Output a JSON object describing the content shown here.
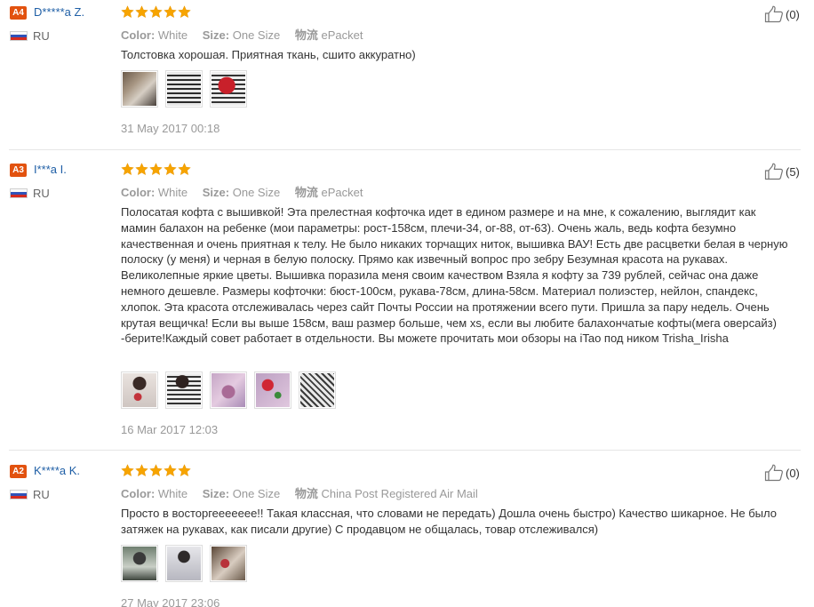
{
  "reviews": [
    {
      "level": "A4",
      "name": "D*****a Z.",
      "country": "RU",
      "rating": 5,
      "color_label": "Color:",
      "color_value": "White",
      "size_label": "Size:",
      "size_value": "One Size",
      "shipping_label": "物流",
      "shipping_value": "ePacket",
      "text": "Толстовка хорошая. Приятная ткань, сшито аккуратно)",
      "date": "31 May 2017 00:18",
      "helpful_count": "(0)"
    },
    {
      "level": "A3",
      "name": "I***a I.",
      "country": "RU",
      "rating": 5,
      "color_label": "Color:",
      "color_value": "White",
      "size_label": "Size:",
      "size_value": "One Size",
      "shipping_label": "物流",
      "shipping_value": "ePacket",
      "text": "Полосатая кофта с вышивкой! Эта прелестная кофточка идет в едином размере и на мне, к сожалению, выглядит как мамин балахон на ребенке (мои параметры: рост-158см, плечи-34, ог-88, от-63). Очень жаль, ведь кофта безумно качественная и очень приятная к телу. Не было никаких торчащих ниток, вышивка ВАУ! Есть две расцветки белая в черную полоску (у меня) и черная в белую полоску. Прямо как извечный вопрос про зебру Безумная красота на рукавах. Великолепные яркие цветы. Вышивка поразила меня своим качеством Взяла я кофту за 739 рублей, сейчас она даже немного дешевле. Размеры кофточки: бюст-100см, рукава-78см, длина-58см. Материал полиэстер, нейлон, спандекс, хлопок. Эта красота отслеживалась через сайт Почты России на протяжении всего пути. Пришла за пару недель. Очень крутая вещичка! Если вы выше 158см, ваш размер больше, чем xs, если вы любите балахончатые кофты(мега оверсайз) -берите!Каждый совет работает в отдельности. Вы можете прочитать мои обзоры на iTao под ником Trisha_Irisha",
      "date": "16 Mar 2017 12:03",
      "helpful_count": "(5)"
    },
    {
      "level": "A2",
      "name": "K****a K.",
      "country": "RU",
      "rating": 5,
      "color_label": "Color:",
      "color_value": "White",
      "size_label": "Size:",
      "size_value": "One Size",
      "shipping_label": "物流",
      "shipping_value": "China Post Registered Air Mail",
      "text": "Просто в восторгеееееее!! Такая классная, что словами не передать) Дошла очень быстро) Качество шикарное. Не было затяжек на рукавах, как писали другие) С продавцом не общалась, товар отслеживался)",
      "date": "27 May 2017 23:06",
      "helpful_count": "(0)"
    }
  ],
  "colors": {
    "badge": "#e2520f",
    "star": "#f7a400",
    "name": "#1f5fa6",
    "muted": "#999999"
  },
  "icons": {
    "star": "star-icon",
    "thumbs_up": "thumbs-up-icon",
    "flag": "russia-flag-icon"
  }
}
